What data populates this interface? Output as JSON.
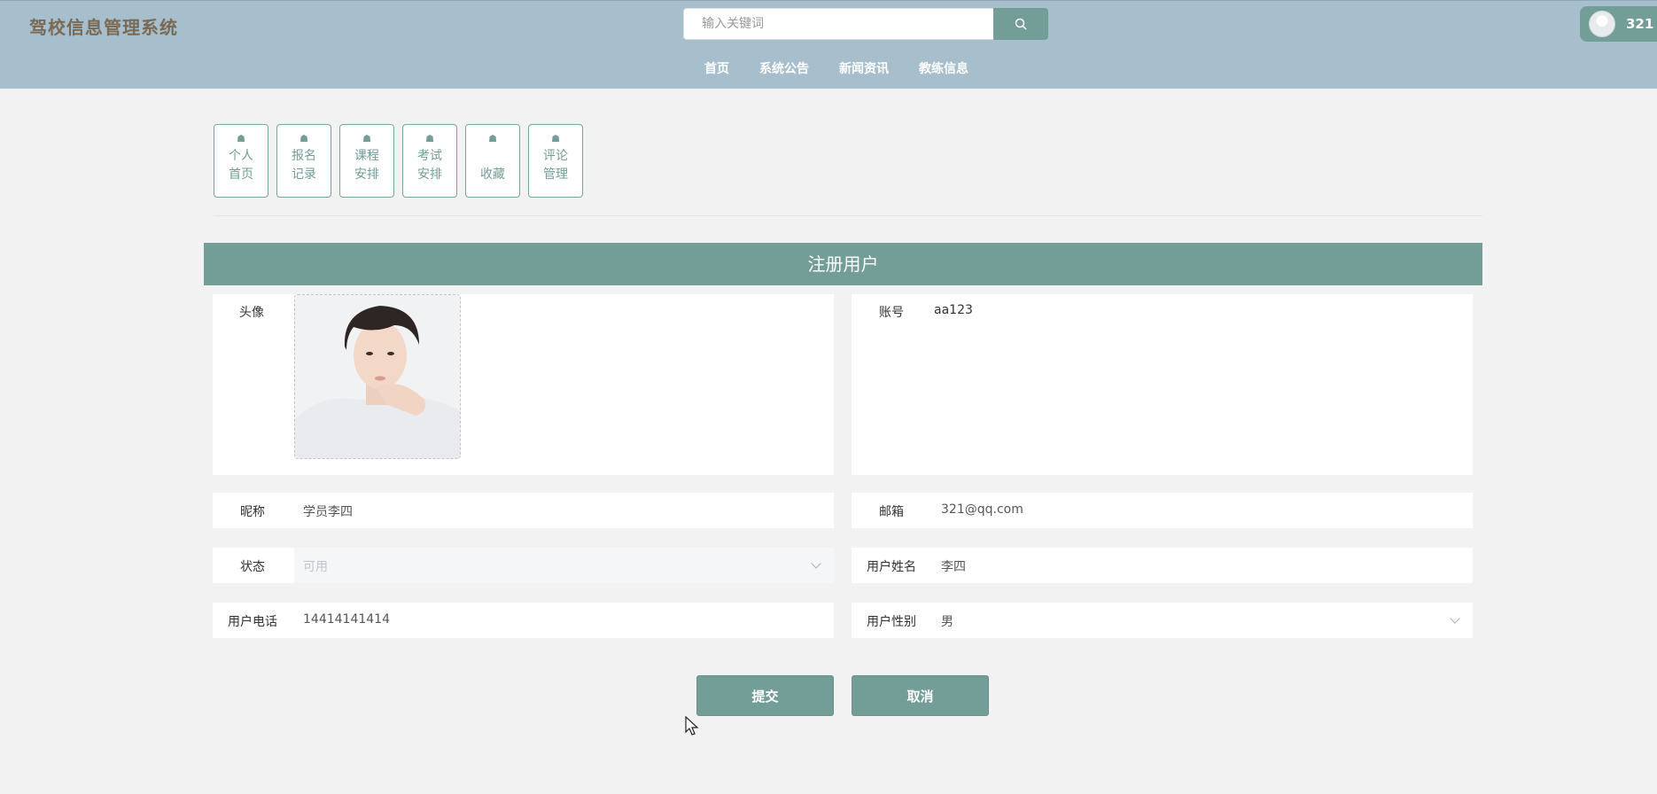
{
  "header": {
    "app_title": "驾校信息管理系统",
    "search_placeholder": "输入关键词",
    "nav": [
      "首页",
      "系统公告",
      "新闻资讯",
      "教练信息"
    ],
    "user_name": "321"
  },
  "menu": [
    {
      "label_line1": "个人",
      "label_line2": "首页"
    },
    {
      "label_line1": "报名",
      "label_line2": "记录"
    },
    {
      "label_line1": "课程",
      "label_line2": "安排"
    },
    {
      "label_line1": "考试",
      "label_line2": "安排"
    },
    {
      "label_line1": "",
      "label_line2": "收藏"
    },
    {
      "label_line1": "评论",
      "label_line2": "管理"
    }
  ],
  "form": {
    "title": "注册用户",
    "avatar_label": "头像",
    "account_label": "账号",
    "account_value": "aa123",
    "nickname_label": "昵称",
    "nickname_value": "学员李四",
    "email_label": "邮箱",
    "email_value": "321@qq.com",
    "status_label": "状态",
    "status_value": "可用",
    "realname_label": "用户姓名",
    "realname_value": "李四",
    "phone_label": "用户电话",
    "phone_value": "14414141414",
    "gender_label": "用户性别",
    "gender_value": "男",
    "submit_label": "提交",
    "cancel_label": "取消"
  },
  "colors": {
    "header_bg": "#a7bfcc",
    "accent": "#739d97",
    "page_bg": "#f2f2f2"
  }
}
